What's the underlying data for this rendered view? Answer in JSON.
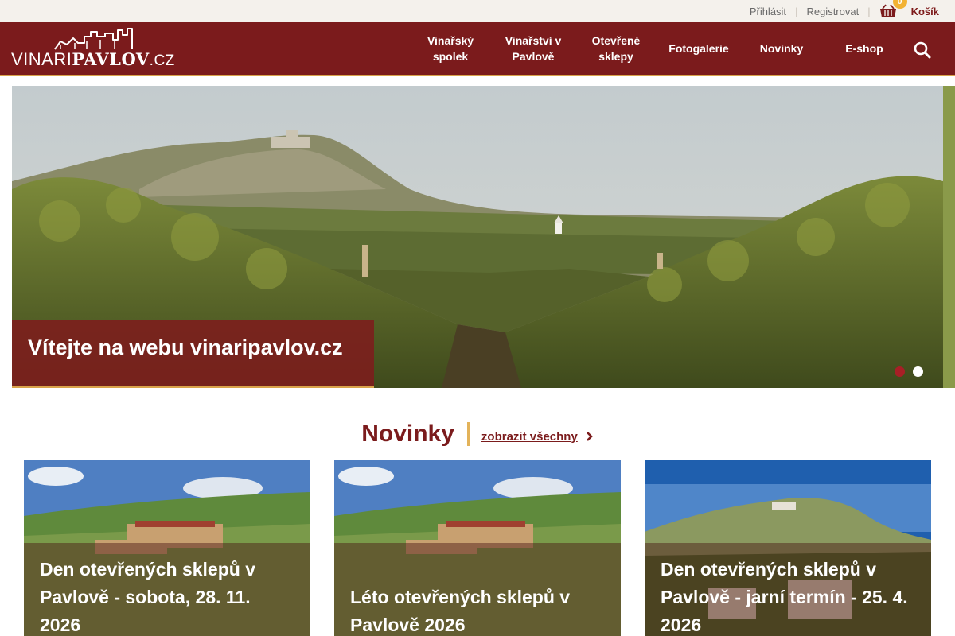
{
  "topbar": {
    "login": "Přihlásit",
    "register": "Registrovat",
    "cart_count": "0",
    "cart_label": "Košík"
  },
  "logo": {
    "part1": "VINARI",
    "part2": "PAVLOV",
    "part3": ".CZ"
  },
  "nav": {
    "items": [
      {
        "label": "Vinařský spolek"
      },
      {
        "label": "Vinařství v Pavlově"
      },
      {
        "label": "Otevřené sklepy"
      },
      {
        "label": "Fotogalerie"
      },
      {
        "label": "Novinky"
      },
      {
        "label": "E-shop"
      }
    ],
    "search_icon": "search-icon"
  },
  "hero": {
    "caption": "Vítejte na webu vinaripavlov.cz",
    "slides": 2,
    "active_slide": 1
  },
  "news": {
    "title": "Novinky",
    "show_all": "zobrazit všechny",
    "cards": [
      {
        "title": "Den otevřených sklepů v Pavlově - sobota, 28. 11. 2026"
      },
      {
        "title": "Léto otevřených sklepů v Pavlově 2026"
      },
      {
        "title": "Den otevřených sklepů v Pavlově - jarní termín - 25. 4. 2026"
      }
    ]
  },
  "colors": {
    "brand": "#7b1b1c",
    "accent": "#d9a34a",
    "badge": "#f2b233"
  }
}
